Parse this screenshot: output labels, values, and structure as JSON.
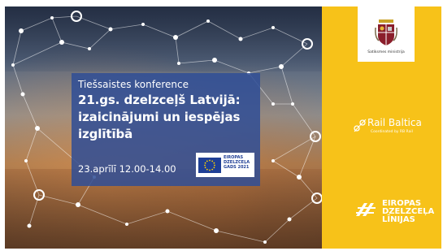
{
  "conference": {
    "subtitle": "Tiešsaistes konference",
    "title_lines": [
      "21.gs. dzelzceļš Latvijā:",
      "izaicinājumi un iespējas",
      "izglītībā"
    ],
    "date_time": "23.aprīlī  12.00-14.00"
  },
  "eu_badge": {
    "lines": [
      "EIROPAS",
      "DZELZCEĻA",
      "GADS 2021"
    ]
  },
  "ministry_logo": {
    "label": "Satiksmes ministrija"
  },
  "rail_baltica": {
    "name": "Rail Baltica",
    "tagline": "Coordinated by RB Rail"
  },
  "edl_logo": {
    "lines": [
      "EIROPAS",
      "DZELZCEĻA",
      "LĪNIJAS"
    ]
  },
  "colors": {
    "panel": "#304e96",
    "sidebar": "#f7c219",
    "eu_blue": "#1f3f95"
  },
  "icons": [
    "network-node-icon",
    "eu-flag-icon",
    "coat-of-arms-icon",
    "rail-baltica-swirl-icon",
    "edl-rails-icon"
  ]
}
